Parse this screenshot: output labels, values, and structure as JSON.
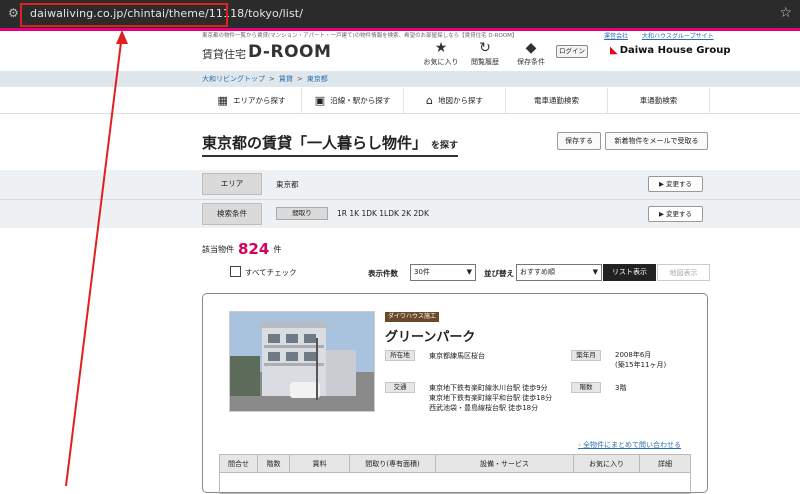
{
  "browser": {
    "url": "daiwaliving.co.jp/chintai/theme/11118/tokyo/list/"
  },
  "header": {
    "description": "東京都の物件一覧から賃貸(マンション・アパート・一戸建て)の物件情報を検索、希望のお部屋探しなら【賃貸住宅 D-ROOM】",
    "logo_sub": "賃貸住宅",
    "logo": "D-ROOM",
    "favorites": "お気に入り",
    "history": "閲覧履歴",
    "saved": "保存条件",
    "login": "ログイン",
    "links": [
      "運営会社",
      "大和ハウスグループサイト"
    ],
    "group_logo": "Daiwa House Group"
  },
  "breadcrumb": [
    "大和リビングトップ",
    "賃貸",
    "東京都"
  ],
  "nav": [
    {
      "label": "エリアから探す",
      "icon": "map-area-icon"
    },
    {
      "label": "沿線・駅から探す",
      "icon": "train-icon"
    },
    {
      "label": "地図から探す",
      "icon": "map-pin-icon"
    },
    {
      "label": "電車通勤検索",
      "icon": ""
    },
    {
      "label": "車通勤検索",
      "icon": ""
    }
  ],
  "page": {
    "title": "東京都の賃貸「一人暮らし物件」",
    "title_suffix": "を探す",
    "save_button": "保存する",
    "mail_button": "新着物件をメールで受取る"
  },
  "conditions": {
    "area_label": "エリア",
    "area_value": "東京都",
    "change_label": "▶ 変更する",
    "search_label": "検索条件",
    "layout_tag": "間取り",
    "layout_value": "1R 1K 1DK 1LDK 2K 2DK"
  },
  "results": {
    "count_prefix": "該当物件",
    "count": "824",
    "count_suffix": "件",
    "check_all": "すべてチェック",
    "per_page_label": "表示件数",
    "per_page_value": "30件",
    "sort_label": "並び替え",
    "sort_value": "おすすめ順",
    "list_view": "リスト表示",
    "map_view": "地図表示"
  },
  "property": {
    "maker": "ダイワハウス施工",
    "name": "グリーンパーク",
    "location_label": "所在地",
    "location": "東京都練馬区桜台",
    "built_label": "築年月",
    "built": "2008年6月",
    "built_age": "(築15年11ヶ月)",
    "transport_label": "交通",
    "transport": [
      "東京地下鉄有楽町線氷川台駅 徒歩9分",
      "東京地下鉄有楽町線平和台駅 徒歩18分",
      "西武池袋・豊島線桜台駅 徒歩18分"
    ],
    "floors_label": "階数",
    "floors": "3階",
    "inquiry": "全物件にまとめて問い合わせる",
    "columns": [
      "間合せ",
      "階数",
      "賃料",
      "間取り(専有面積)",
      "設備・サービス",
      "お気に入り",
      "詳細"
    ]
  }
}
